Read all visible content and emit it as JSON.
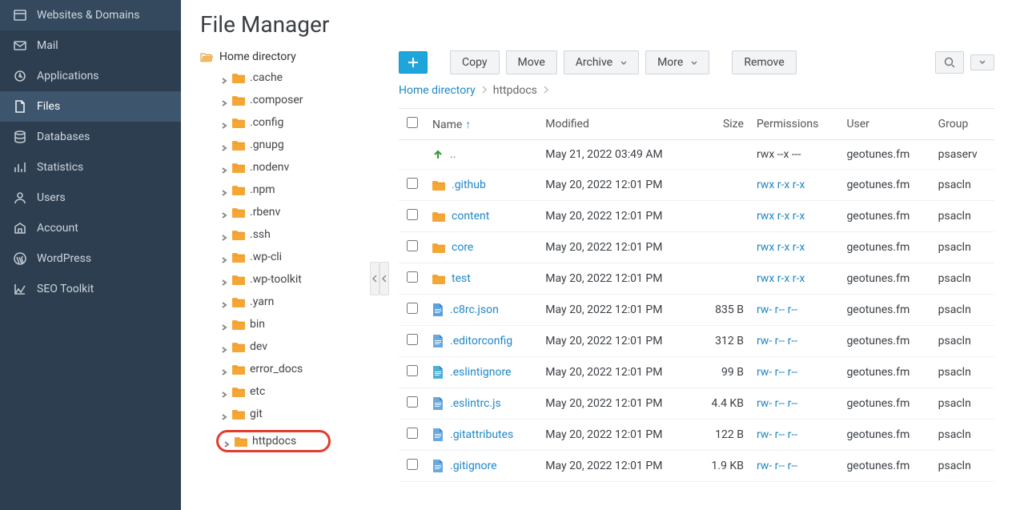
{
  "sidebar": {
    "items": [
      {
        "label": "Websites & Domains",
        "icon": "websites"
      },
      {
        "label": "Mail",
        "icon": "mail"
      },
      {
        "label": "Applications",
        "icon": "applications"
      },
      {
        "label": "Files",
        "icon": "files",
        "active": true
      },
      {
        "label": "Databases",
        "icon": "databases"
      },
      {
        "label": "Statistics",
        "icon": "statistics"
      },
      {
        "label": "Users",
        "icon": "users"
      },
      {
        "label": "Account",
        "icon": "account"
      },
      {
        "label": "WordPress",
        "icon": "wordpress"
      },
      {
        "label": "SEO Toolkit",
        "icon": "seo"
      }
    ]
  },
  "page": {
    "title": "File Manager"
  },
  "tree": {
    "root_label": "Home directory",
    "nodes": [
      {
        "label": ".cache"
      },
      {
        "label": ".composer"
      },
      {
        "label": ".config"
      },
      {
        "label": ".gnupg"
      },
      {
        "label": ".nodenv"
      },
      {
        "label": ".npm"
      },
      {
        "label": ".rbenv"
      },
      {
        "label": ".ssh"
      },
      {
        "label": ".wp-cli"
      },
      {
        "label": ".wp-toolkit"
      },
      {
        "label": ".yarn"
      },
      {
        "label": "bin"
      },
      {
        "label": "dev"
      },
      {
        "label": "error_docs"
      },
      {
        "label": "etc"
      },
      {
        "label": "git"
      },
      {
        "label": "httpdocs",
        "highlight": true
      }
    ]
  },
  "toolbar": {
    "add_label": "+",
    "copy_label": "Copy",
    "move_label": "Move",
    "archive_label": "Archive",
    "more_label": "More",
    "remove_label": "Remove"
  },
  "breadcrumb": {
    "link0": "Home directory",
    "current": "httpdocs"
  },
  "table": {
    "headers": {
      "name": "Name",
      "modified": "Modified",
      "size": "Size",
      "permissions": "Permissions",
      "user": "User",
      "group": "Group"
    },
    "sort_indicator": "↑",
    "up_label": "..",
    "up_modified": "May 21, 2022 03:49 AM",
    "up_permissions": "rwx --x ---",
    "up_user": "geotunes.fm",
    "up_group": "psaserv",
    "rows": [
      {
        "type": "folder",
        "name": ".github",
        "modified": "May 20, 2022 12:01 PM",
        "size": "",
        "permissions": "rwx r-x r-x",
        "perm_link": true,
        "user": "geotunes.fm",
        "group": "psacln"
      },
      {
        "type": "folder",
        "name": "content",
        "modified": "May 20, 2022 12:01 PM",
        "size": "",
        "permissions": "rwx r-x r-x",
        "perm_link": true,
        "user": "geotunes.fm",
        "group": "psacln"
      },
      {
        "type": "folder",
        "name": "core",
        "modified": "May 20, 2022 12:01 PM",
        "size": "",
        "permissions": "rwx r-x r-x",
        "perm_link": true,
        "user": "geotunes.fm",
        "group": "psacln"
      },
      {
        "type": "folder",
        "name": "test",
        "modified": "May 20, 2022 12:01 PM",
        "size": "",
        "permissions": "rwx r-x r-x",
        "perm_link": true,
        "user": "geotunes.fm",
        "group": "psacln"
      },
      {
        "type": "file-json",
        "name": ".c8rc.json",
        "modified": "May 20, 2022 12:01 PM",
        "size": "835 B",
        "permissions": "rw- r-- r--",
        "perm_link": true,
        "user": "geotunes.fm",
        "group": "psacln"
      },
      {
        "type": "file-text",
        "name": ".editorconfig",
        "modified": "May 20, 2022 12:01 PM",
        "size": "312 B",
        "permissions": "rw- r-- r--",
        "perm_link": true,
        "user": "geotunes.fm",
        "group": "psacln"
      },
      {
        "type": "file-code",
        "name": ".eslintignore",
        "modified": "May 20, 2022 12:01 PM",
        "size": "99 B",
        "permissions": "rw- r-- r--",
        "perm_link": true,
        "user": "geotunes.fm",
        "group": "psacln"
      },
      {
        "type": "file-text",
        "name": ".eslintrc.js",
        "modified": "May 20, 2022 12:01 PM",
        "size": "4.4 KB",
        "permissions": "rw- r-- r--",
        "perm_link": true,
        "user": "geotunes.fm",
        "group": "psacln"
      },
      {
        "type": "file-text",
        "name": ".gitattributes",
        "modified": "May 20, 2022 12:01 PM",
        "size": "122 B",
        "permissions": "rw- r-- r--",
        "perm_link": true,
        "user": "geotunes.fm",
        "group": "psacln"
      },
      {
        "type": "file-text",
        "name": ".gitignore",
        "modified": "May 20, 2022 12:01 PM",
        "size": "1.9 KB",
        "permissions": "rw- r-- r--",
        "perm_link": true,
        "user": "geotunes.fm",
        "group": "psacln"
      }
    ]
  }
}
